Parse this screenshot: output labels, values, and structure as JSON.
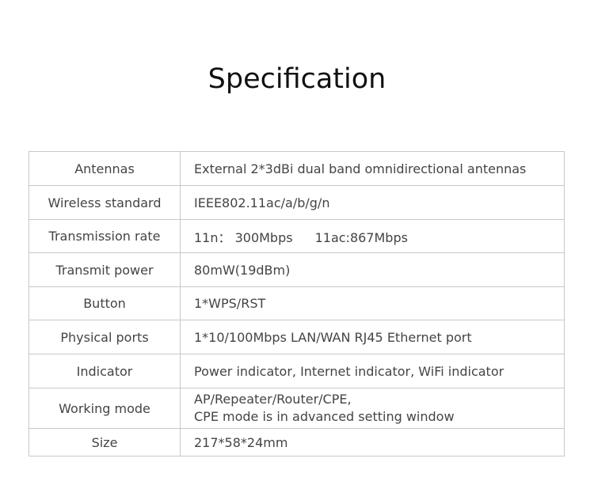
{
  "title": "Specification",
  "rows": [
    {
      "label": "Antennas",
      "value": "External 2*3dBi dual band omnidirectional antennas"
    },
    {
      "label": "Wireless standard",
      "value": "IEEE802.11ac/a/b/g/n"
    },
    {
      "label": "Transmission rate",
      "value_a": "11n： 300Mbps",
      "value_b": "11ac:867Mbps"
    },
    {
      "label": "Transmit power",
      "value": "80mW(19dBm)"
    },
    {
      "label": "Button",
      "value": "1*WPS/RST"
    },
    {
      "label": "Physical ports",
      "value": "1*10/100Mbps LAN/WAN RJ45 Ethernet port"
    },
    {
      "label": "Indicator",
      "value": "Power indicator, Internet indicator, WiFi indicator"
    },
    {
      "label": "Working mode",
      "value_line1": "AP/Repeater/Router/CPE,",
      "value_line2": "CPE mode is in advanced setting window"
    },
    {
      "label": "Size",
      "value": "217*58*24mm"
    }
  ]
}
